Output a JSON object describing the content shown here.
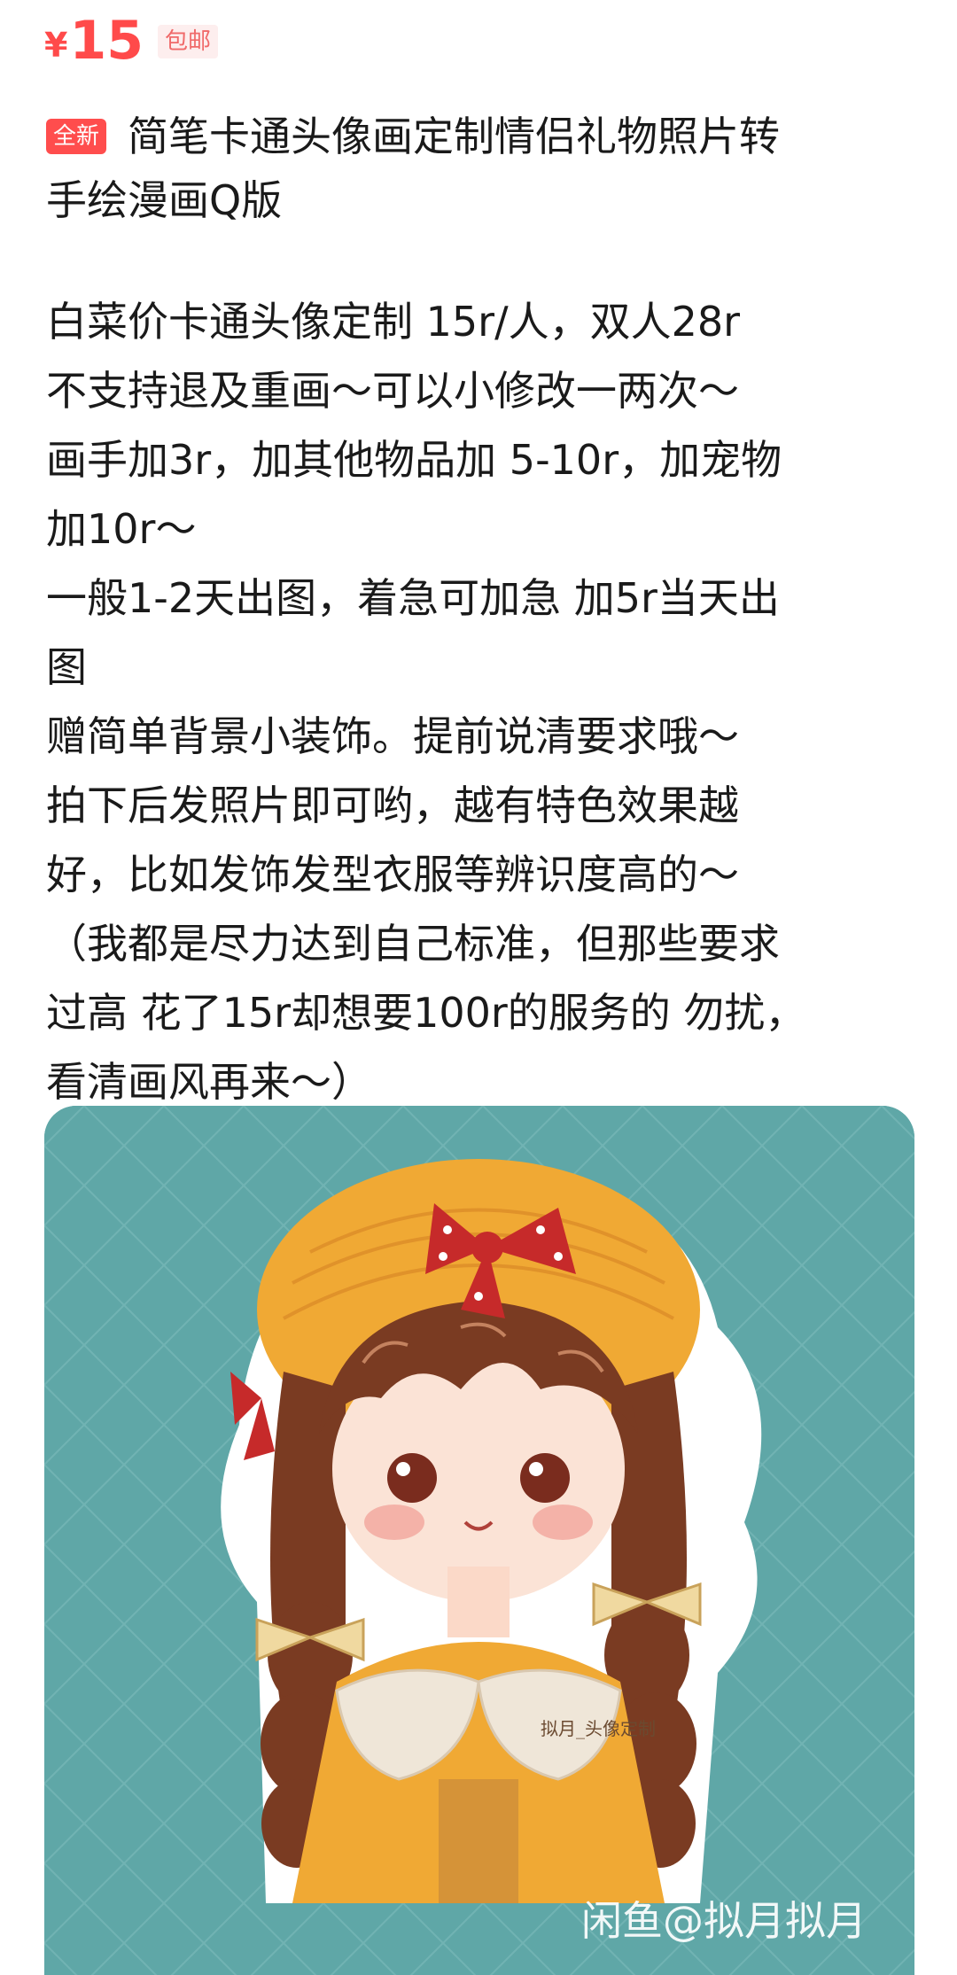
{
  "price": {
    "currency": "¥",
    "amount": "15",
    "shipping": "包邮"
  },
  "title": {
    "badge": "全新",
    "line1": "简笔卡通头像画定制情侣礼物照片转",
    "line2": "手绘漫画Q版"
  },
  "description": {
    "lines": [
      "白菜价卡通头像定制 15r/人，双人28r",
      "不支持退及重画～可以小修改一两次～",
      "画手加3r，加其他物品加 5-10r，加宠物",
      "加10r～",
      "一般1-2天出图，着急可加急 加5r当天出",
      "图",
      "赠简单背景小装饰。提前说清要求哦～",
      "拍下后发照片即可哟，越有特色效果越",
      "好，比如发饰发型衣服等辨识度高的～",
      "（我都是尽力达到自己标准，但那些要求",
      "过高 花了15r却想要100r的服务的 勿扰，",
      "看清画风再来～）"
    ]
  },
  "image": {
    "signature": "拟月_头像定制",
    "watermark": "闲鱼@拟月拟月"
  },
  "colors": {
    "price": "#ff4a4a",
    "badge": "#ff4d4d",
    "background_teal": "#5fa7a7",
    "hat_yellow": "#f0a934",
    "hair_brown": "#7a3b22",
    "bow_red": "#c62a2a"
  }
}
